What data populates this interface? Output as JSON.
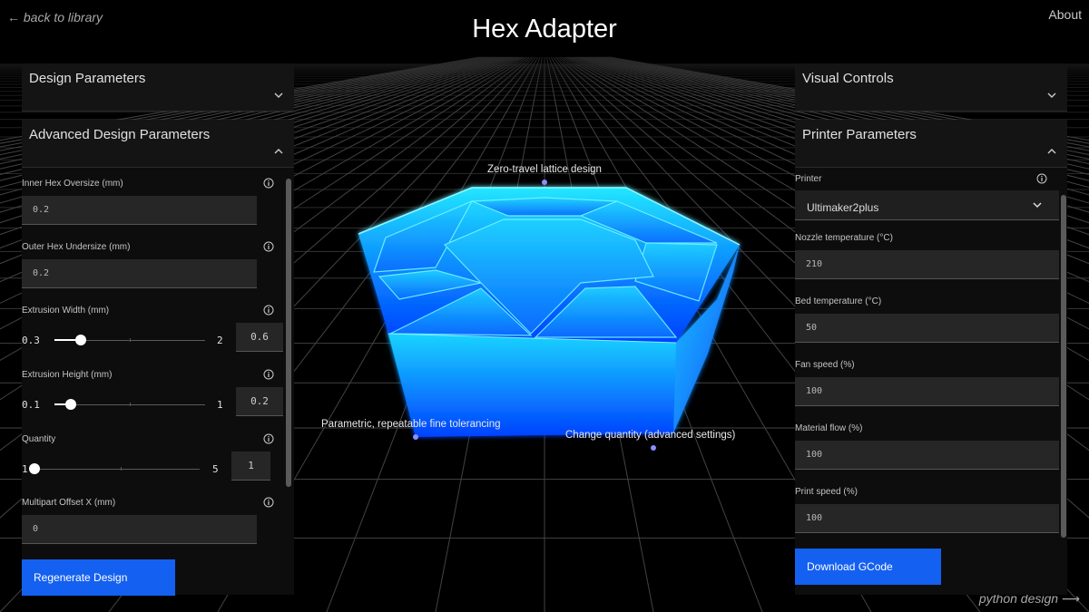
{
  "header": {
    "back_label": "← back to library",
    "title": "Hex Adapter",
    "about_label": "About"
  },
  "footer": {
    "python_label": "python design ⟶"
  },
  "left": {
    "design_params_label": "Design Parameters",
    "advanced_label": "Advanced Design Parameters",
    "fields": {
      "inner_hex": {
        "label": "Inner Hex Oversize (mm)",
        "value": "0.2"
      },
      "outer_hex": {
        "label": "Outer Hex Undersize (mm)",
        "value": "0.2"
      },
      "extrusion_width": {
        "label": "Extrusion Width (mm)",
        "min": "0.3",
        "max": "2",
        "value": "0.6",
        "min_num": 0.3,
        "max_num": 2,
        "value_num": 0.6
      },
      "extrusion_height": {
        "label": "Extrusion Height (mm)",
        "min": "0.1",
        "max": "1",
        "value": "0.2",
        "min_num": 0.1,
        "max_num": 1,
        "value_num": 0.2
      },
      "quantity": {
        "label": "Quantity",
        "min": "1",
        "max": "5",
        "value": "1",
        "min_num": 1,
        "max_num": 5,
        "value_num": 1
      },
      "multipart_offset_x": {
        "label": "Multipart Offset X (mm)",
        "value": "0"
      }
    },
    "regenerate_label": "Regenerate Design"
  },
  "right": {
    "visual_controls_label": "Visual Controls",
    "printer_params_label": "Printer Parameters",
    "printer": {
      "label": "Printer",
      "value": "Ultimaker2plus"
    },
    "nozzle_temp": {
      "label": "Nozzle temperature (°C)",
      "value": "210"
    },
    "bed_temp": {
      "label": "Bed temperature (°C)",
      "value": "50"
    },
    "fan_speed": {
      "label": "Fan speed (%)",
      "value": "100"
    },
    "material_flow": {
      "label": "Material flow (%)",
      "value": "100"
    },
    "print_speed": {
      "label": "Print speed (%)",
      "value": "100"
    },
    "download_label": "Download GCode"
  },
  "viewport": {
    "annotations": {
      "lattice": "Zero-travel lattice design",
      "tolerancing": "Parametric, repeatable fine tolerancing",
      "quantity": "Change quantity (advanced settings)"
    }
  },
  "colors": {
    "accent": "#1460f0",
    "model_top": "#20e0ff",
    "model_bottom": "#0040ff",
    "annotation_dot": "#8d8cff"
  }
}
